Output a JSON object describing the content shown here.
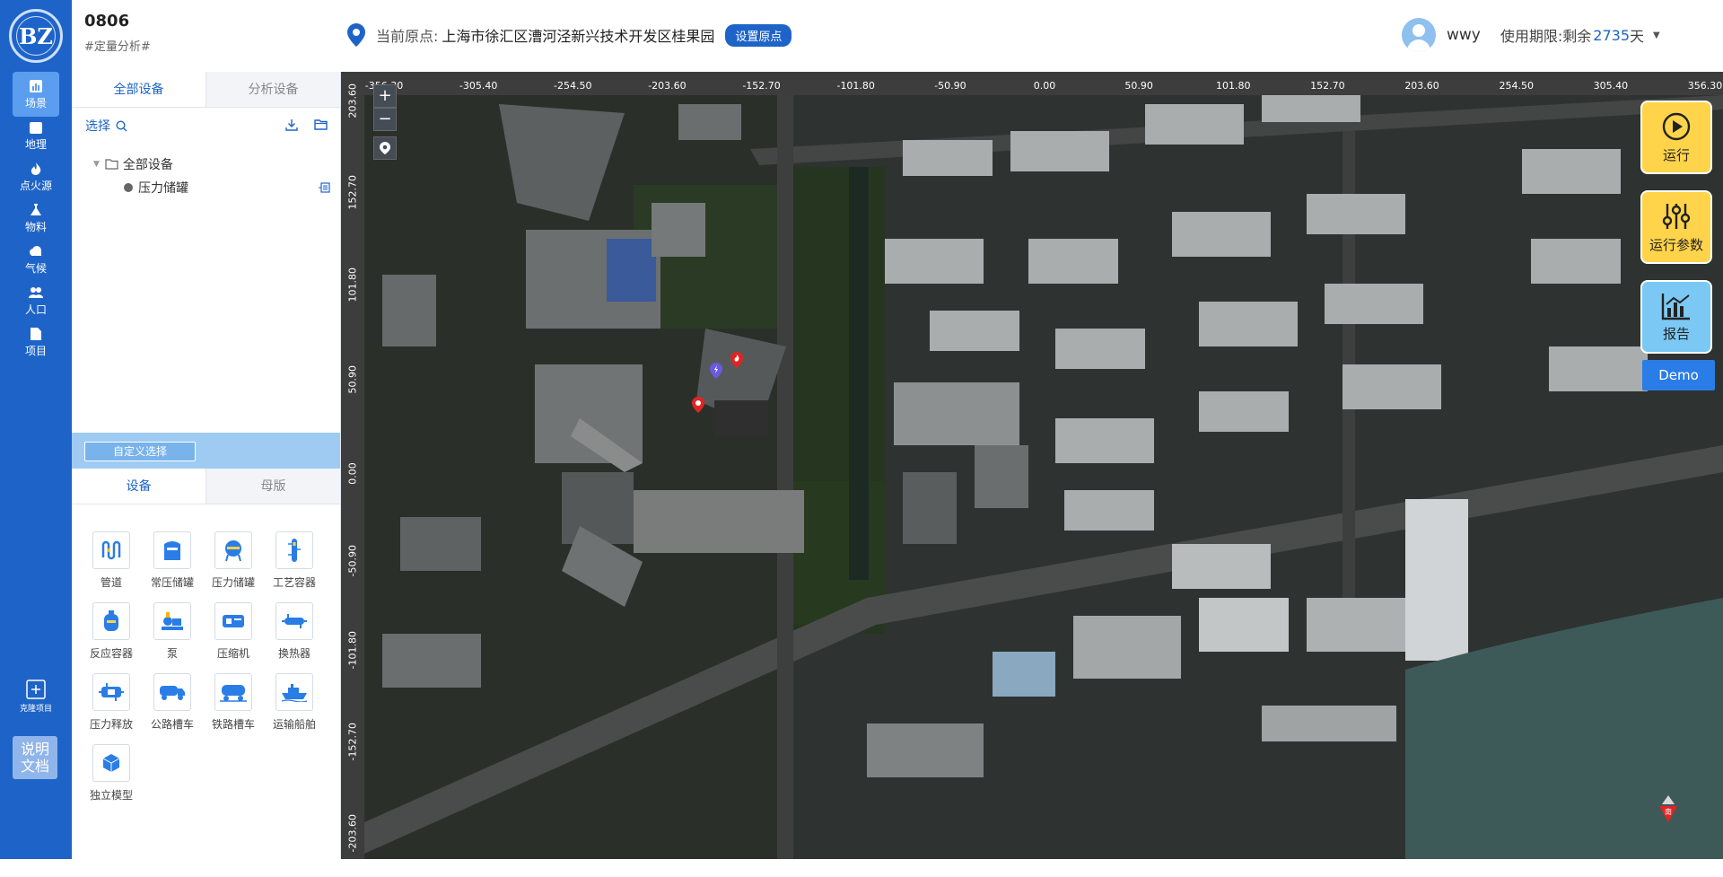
{
  "logo": {
    "text": "BZ"
  },
  "nav": {
    "items": [
      {
        "label": "场景",
        "icon": "chart-bar-icon",
        "active": true
      },
      {
        "label": "地理",
        "icon": "map-icon",
        "active": false
      },
      {
        "label": "点火源",
        "icon": "fire-icon",
        "active": false
      },
      {
        "label": "物料",
        "icon": "flask-icon",
        "active": false
      },
      {
        "label": "气候",
        "icon": "cloud-icon",
        "active": false
      },
      {
        "label": "人口",
        "icon": "people-icon",
        "active": false
      },
      {
        "label": "项目",
        "icon": "document-icon",
        "active": false
      }
    ],
    "clone_label": "克隆项目",
    "doc_label": "说明文档"
  },
  "header": {
    "project_title": "0806",
    "project_subtitle": "#定量分析#",
    "location_label": "当前原点:",
    "location_address": "上海市徐汇区漕河泾新兴技术开发区桂果园",
    "set_origin_button": "设置原点",
    "username": "wwy",
    "expiry_label": "使用期限:剩余",
    "expiry_days": "2735",
    "expiry_unit": "天"
  },
  "panel": {
    "tabs": [
      {
        "label": "全部设备",
        "active": true
      },
      {
        "label": "分析设备",
        "active": false
      }
    ],
    "select_label": "选择",
    "tree": {
      "root": "全部设备",
      "children": [
        "压力储罐"
      ]
    },
    "custom_select_button": "自定义选择",
    "lower_tabs": [
      {
        "label": "设备",
        "active": true
      },
      {
        "label": "母版",
        "active": false
      }
    ],
    "equipment": [
      {
        "label": "管道",
        "icon": "pipe-icon"
      },
      {
        "label": "常压储罐",
        "icon": "atmospheric-tank-icon"
      },
      {
        "label": "压力储罐",
        "icon": "pressure-tank-icon"
      },
      {
        "label": "工艺容器",
        "icon": "process-vessel-icon"
      },
      {
        "label": "反应容器",
        "icon": "reactor-icon"
      },
      {
        "label": "泵",
        "icon": "pump-icon"
      },
      {
        "label": "压缩机",
        "icon": "compressor-icon"
      },
      {
        "label": "换热器",
        "icon": "heat-exchanger-icon"
      },
      {
        "label": "压力释放",
        "icon": "pressure-relief-icon"
      },
      {
        "label": "公路槽车",
        "icon": "road-tanker-icon"
      },
      {
        "label": "铁路槽车",
        "icon": "rail-tanker-icon"
      },
      {
        "label": "运输船舶",
        "icon": "ship-icon"
      },
      {
        "label": "独立模型",
        "icon": "cube-icon"
      }
    ]
  },
  "map": {
    "ruler_x": [
      "-356.30",
      "-305.40",
      "-254.50",
      "-203.60",
      "-152.70",
      "-101.80",
      "-50.90",
      "0.00",
      "50.90",
      "101.80",
      "152.70",
      "203.60",
      "254.50",
      "305.40",
      "356.30"
    ],
    "ruler_y": [
      "203.60",
      "152.70",
      "101.80",
      "50.90",
      "0.00",
      "-50.90",
      "-101.80",
      "-152.70",
      "-203.60"
    ],
    "zoom_in": "+",
    "zoom_out": "−",
    "compass_label": "南"
  },
  "actions": {
    "run": "运行",
    "run_params": "运行参数",
    "report": "报告",
    "demo": "Demo"
  },
  "colors": {
    "primary": "#1e64c8",
    "accent_yellow": "#ffd44a",
    "accent_blue": "#7cc8f5"
  }
}
